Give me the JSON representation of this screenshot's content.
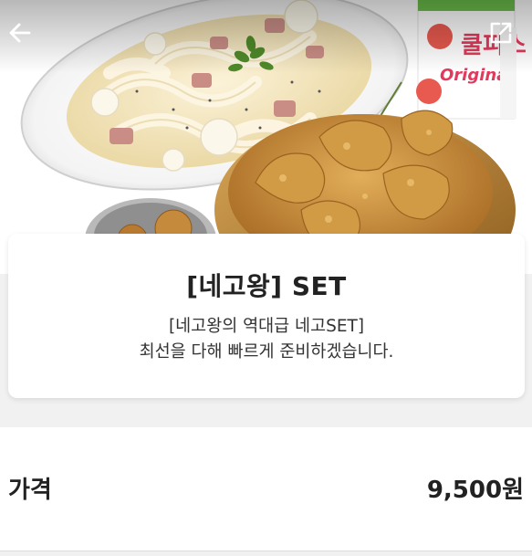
{
  "header": {
    "back_icon": "arrow-left-icon",
    "share_icon": "external-link-icon"
  },
  "hero_image": {
    "carton_text": "쿨피스 Original"
  },
  "product": {
    "title": "[네고왕] SET",
    "description_lines": [
      "[네고왕의 역대급 네고SET]",
      "최선을 다해 빠르게 준비하겠습니다."
    ]
  },
  "price": {
    "label": "가격",
    "value": "9,500원"
  },
  "colors": {
    "background": "#f1f1f1",
    "card": "#ffffff",
    "text": "#222222",
    "cream_sauce": "#f3e7c4",
    "fried_chicken": "#c88f3c",
    "carton_pink": "#e23a5c"
  }
}
